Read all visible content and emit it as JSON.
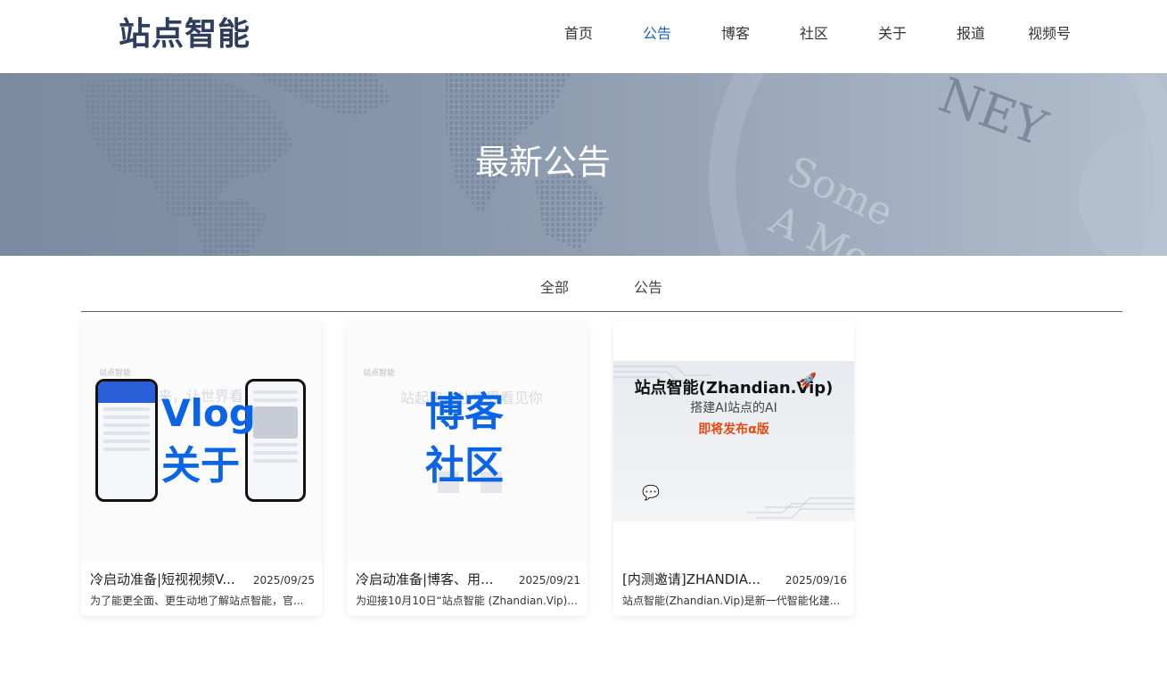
{
  "header": {
    "logo": "站点智能",
    "nav": [
      "首页",
      "公告",
      "博客",
      "社区",
      "关于",
      "报道",
      "视频号"
    ],
    "active_index": 1,
    "active_color": "#1e62b8"
  },
  "banner": {
    "title": "最新公告",
    "watermark_text": [
      "Some",
      "A More",
      "NEY"
    ]
  },
  "tabs": [
    "全部",
    "公告"
  ],
  "cards": [
    {
      "title": "冷启动准备|短视视频V...",
      "date": "2025/09/25",
      "desc": "为了能更全面、更生动地了解站点智能，官...",
      "thumb": {
        "brand": "站点智能",
        "bg_text": "起来，让世界看见",
        "big_text": [
          "Vlog",
          "关于"
        ]
      }
    },
    {
      "title": "冷启动准备|博客、用...",
      "date": "2025/09/21",
      "desc": "为迎接10月10日“站点智能 (Zhandian.Vip)...",
      "thumb": {
        "brand": "站点智能",
        "bg_text": "站起来，让世界看见你",
        "big_text": [
          "博客",
          "社区"
        ]
      }
    },
    {
      "title": "[内测邀请]ZHANDIA...",
      "date": "2025/09/16",
      "desc": "站点智能(Zhandian.Vip)是新一代智能化建...",
      "thumb": {
        "headline": "站点智能(Zhandian.Vip)",
        "sub": "搭建AI站点的AI",
        "tag": "即将发布α版"
      }
    }
  ],
  "icons": {
    "rocket": "rocket-icon",
    "chat": "chat-bubble-icon"
  }
}
